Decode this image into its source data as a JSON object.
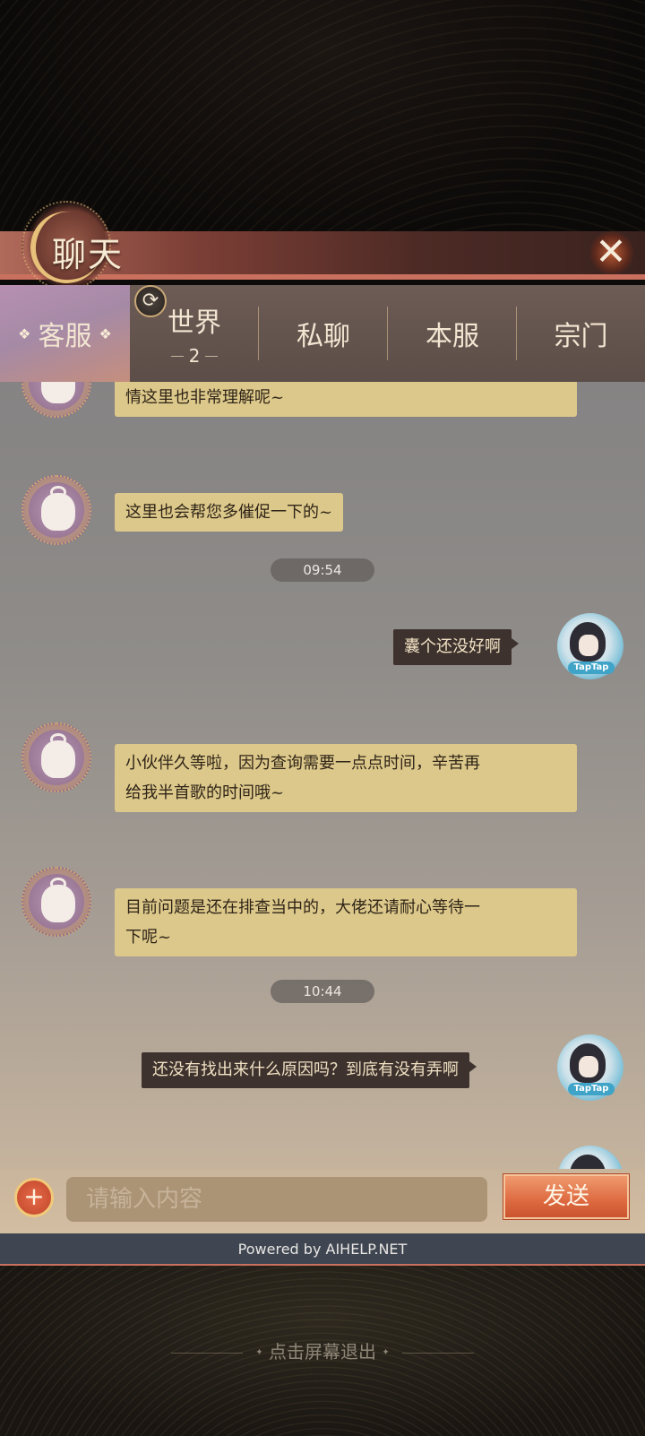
{
  "header": {
    "title": "聊天",
    "close_glyph": "✕"
  },
  "tabs": [
    {
      "label": "客服",
      "active": true
    },
    {
      "label": "世界",
      "badge": "2"
    },
    {
      "label": "私聊"
    },
    {
      "label": "本服"
    },
    {
      "label": "宗门"
    }
  ],
  "refresh_icon": "⟳",
  "messages": [
    {
      "from": "service",
      "text": "情这里也非常理解呢~"
    },
    {
      "from": "service",
      "text": "这里也会帮您多催促一下的~"
    },
    {
      "type": "time",
      "text": "09:54"
    },
    {
      "from": "user",
      "text": "囊个还没好啊",
      "avatar_tag": "TapTap"
    },
    {
      "from": "service",
      "line1": "小伙伴久等啦，因为查询需要一点点时间，辛苦再",
      "line2": "给我半首歌的时间哦~"
    },
    {
      "from": "service",
      "line1": "目前问题是还在排查当中的，大佬还请耐心等待一",
      "line2": "下呢~"
    },
    {
      "type": "time",
      "text": "10:44"
    },
    {
      "from": "user",
      "text": "还没有找出来什么原因吗？到底有没有弄啊",
      "avatar_tag": "TapTap"
    }
  ],
  "input": {
    "placeholder": "请输入内容",
    "value": "",
    "plus_glyph": "+",
    "send_label": "发送"
  },
  "footer": {
    "powered_by": "Powered by AIHELP.NET",
    "exit_hint": "点击屏幕退出"
  },
  "colors": {
    "service_bubble": "#dcc88a",
    "user_bubble": "#3d322d",
    "accent": "#c9715e",
    "send_button": "#de6a41"
  }
}
